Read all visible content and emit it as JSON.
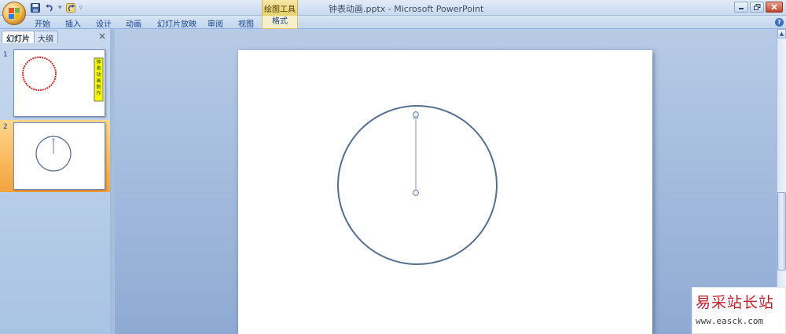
{
  "window": {
    "title": "钟表动画.pptx - Microsoft PowerPoint",
    "context_tab_group": "绘图工具"
  },
  "ribbon": {
    "tabs": [
      "开始",
      "插入",
      "设计",
      "动画",
      "幻灯片放映",
      "审阅",
      "视图",
      "格式"
    ],
    "help_label": "?"
  },
  "left_pane": {
    "tabs": [
      "幻灯片",
      "大纲"
    ],
    "close_label": "×",
    "thumbnails": [
      {
        "number": "1",
        "vertical_text": "钟表动画制作",
        "selected": false
      },
      {
        "number": "2",
        "selected": true
      }
    ]
  },
  "watermark": {
    "title": "易采站长站",
    "url": "www.easck.com"
  },
  "icons": {
    "office_button": "office-logo-icon",
    "save": "save-icon",
    "undo": "undo-icon",
    "redo": "redo-icon",
    "customize": "dropdown-arrow-icon",
    "minimize": "minimize-icon",
    "maximize": "maximize-icon",
    "close": "close-icon",
    "help": "help-icon"
  },
  "colors": {
    "clock_stroke": "#556e91",
    "thumb_circle_red": "#d12b2b",
    "thumb_banner_yellow": "#f7f700",
    "selection_orange": "#f4a23c"
  }
}
